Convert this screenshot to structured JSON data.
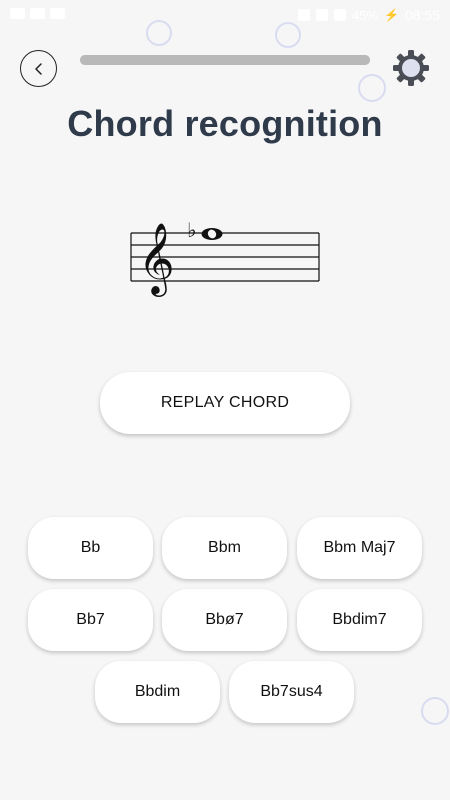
{
  "status_bar": {
    "battery": "45%",
    "time": "08:55"
  },
  "header": {
    "back_icon": "chevron-left-icon",
    "settings_icon": "gear-icon",
    "progress": 1.0,
    "title": "Chord recognition"
  },
  "staff": {
    "clef": "treble-clef",
    "accidental": "♭"
  },
  "replay": {
    "label": "REPLAY CHORD"
  },
  "answers": [
    {
      "label": "Bb"
    },
    {
      "label": "Bbm"
    },
    {
      "label": "Bbm Maj7"
    },
    {
      "label": "Bb7"
    },
    {
      "label": "Bbø7"
    },
    {
      "label": "Bbdim7"
    },
    {
      "label": "Bbdim"
    },
    {
      "label": "Bb7sus4"
    }
  ],
  "colors": {
    "background": "#f6f6f7",
    "title": "#2f3a4a",
    "progress": "#b9b9b9"
  }
}
